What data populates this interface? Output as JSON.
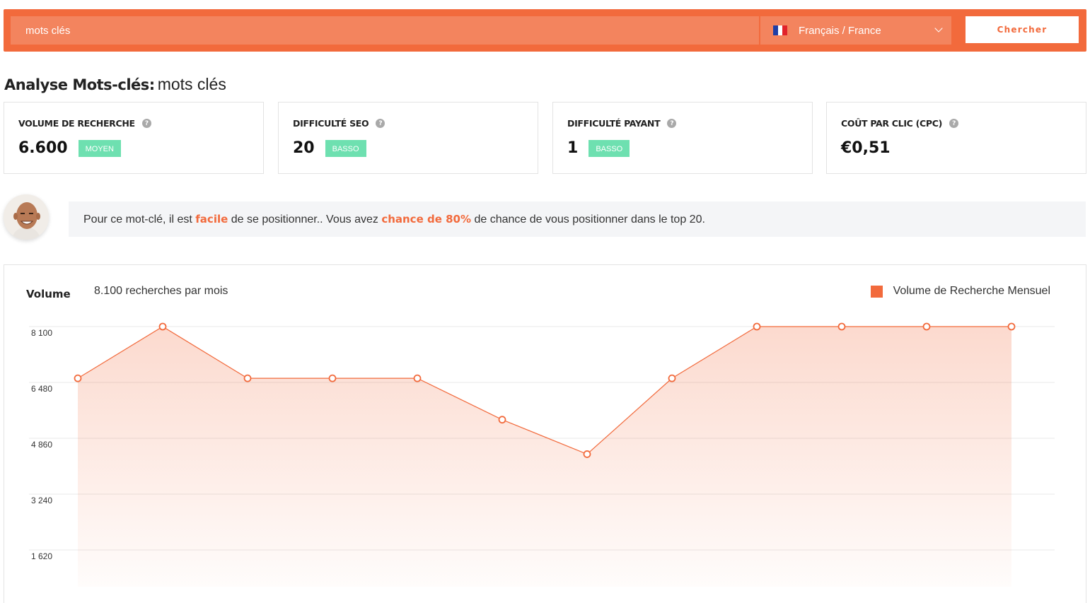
{
  "search": {
    "value": "mots clés",
    "language": "Français / France",
    "button_label": "Chercher"
  },
  "header": {
    "title_bold": "Analyse Mots-clés:",
    "keyword": "mots clés"
  },
  "metrics": [
    {
      "label": "VOLUME DE RECHERCHE",
      "value": "6.600",
      "badge": "MOYEN"
    },
    {
      "label": "DIFFICULTÉ SEO",
      "value": "20",
      "badge": "BASSO"
    },
    {
      "label": "DIFFICULTÉ PAYANT",
      "value": "1",
      "badge": "BASSO"
    },
    {
      "label": "COÛT PAR CLIC (CPC)",
      "value": "€0,51",
      "badge": ""
    }
  ],
  "tip": {
    "part1": "Pour ce mot-clé, il est ",
    "highlight1": "facile",
    "part2": " de se positionner.. Vous avez ",
    "highlight2": "chance de 80%",
    "part3": " de chance de vous positionner dans le top 20."
  },
  "chart_panel": {
    "volume_label": "Volume",
    "volume_sub": "8.100 recherches par mois",
    "legend": "Volume de Recherche Mensuel"
  },
  "colors": {
    "accent": "#f26a3c",
    "badge": "#6ee0b0"
  },
  "chart_data": {
    "type": "area",
    "y_ticks": [
      "8 100",
      "6 480",
      "4 860",
      "3 240",
      "1 620"
    ],
    "ylim": [
      0,
      8100
    ],
    "series": [
      {
        "name": "Volume de Recherche Mensuel",
        "values": [
          6600,
          8100,
          6600,
          6600,
          6600,
          5400,
          4400,
          6600,
          8100,
          8100,
          8100,
          8100
        ]
      }
    ],
    "grid": true,
    "legend_position": "top-right"
  }
}
